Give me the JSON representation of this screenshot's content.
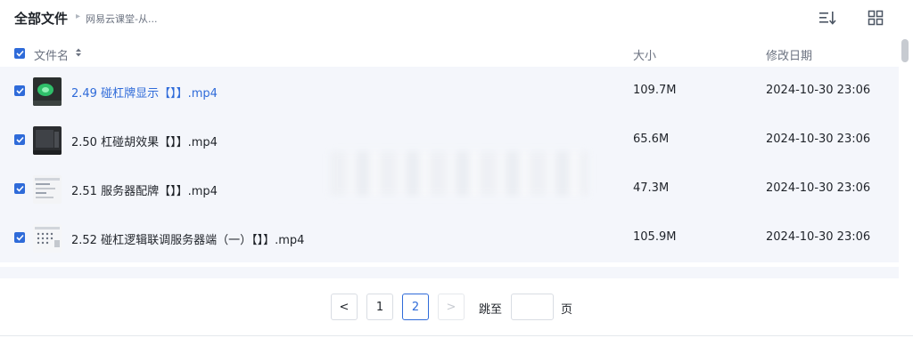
{
  "header": {
    "title": "全部文件",
    "breadcrumb_separator": "▸",
    "breadcrumb_item": "网易云课堂-从..."
  },
  "toolbar": {
    "sort_icon": "sort-list-icon",
    "grid_icon": "grid-view-icon"
  },
  "columns": {
    "name": "文件名",
    "size": "大小",
    "modified": "修改日期"
  },
  "files": [
    {
      "name": "2.49 碰杠牌显示【】】.mp4",
      "size": "109.7M",
      "modified": "2024-10-30 23:06",
      "checked": true
    },
    {
      "name": "2.50 杠碰胡效果【】】.mp4",
      "size": "65.6M",
      "modified": "2024-10-30 23:06",
      "checked": true
    },
    {
      "name": "2.51 服务器配牌【】】.mp4",
      "size": "47.3M",
      "modified": "2024-10-30 23:06",
      "checked": true
    },
    {
      "name": "2.52 碰杠逻辑联调服务器端（一）【】】.mp4",
      "size": "105.9M",
      "modified": "2024-10-30 23:06",
      "checked": true
    }
  ],
  "pagination": {
    "prev": "<",
    "pages": [
      "1",
      "2"
    ],
    "current": "2",
    "next": ">",
    "jump_to": "跳至",
    "page_unit": "页",
    "jump_value": ""
  },
  "colors": {
    "accent": "#2f6bd9",
    "row_bg": "#f4f6fb",
    "muted_text": "#6b7280"
  }
}
